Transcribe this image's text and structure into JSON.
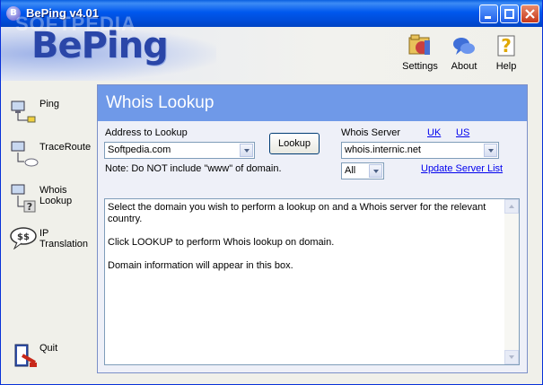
{
  "window": {
    "title": "BePing v4.01",
    "app_icon_letter": "B",
    "logo": "BePing",
    "watermark": "SOFTPEDIA"
  },
  "toolbar": {
    "settings_label": "Settings",
    "about_label": "About",
    "help_label": "Help"
  },
  "sidebar": {
    "items": [
      {
        "label": "Ping"
      },
      {
        "label": "TraceRoute"
      },
      {
        "label": "Whois\nLookup"
      },
      {
        "label": "IP\nTranslation"
      }
    ],
    "quit_label": "Quit"
  },
  "panel": {
    "title": "Whois Lookup",
    "address_label": "Address to Lookup",
    "address_value": "Softpedia.com",
    "lookup_button": "Lookup",
    "note": "Note: Do NOT include \"www\" of domain.",
    "server_label": "Whois Server",
    "uk_link": "UK",
    "us_link": "US",
    "server_value": "whois.internic.net",
    "filter_value": "All",
    "update_link": "Update Server List",
    "output": [
      "Select the domain you wish to perform a lookup on and a Whois server for the relevant country.",
      "Click LOOKUP to perform Whois lookup on domain.",
      "Domain information will appear in this box."
    ]
  },
  "colors": {
    "panel_header": "#6f99e8",
    "link": "#0000ee",
    "titlebar": "#0058ee"
  }
}
